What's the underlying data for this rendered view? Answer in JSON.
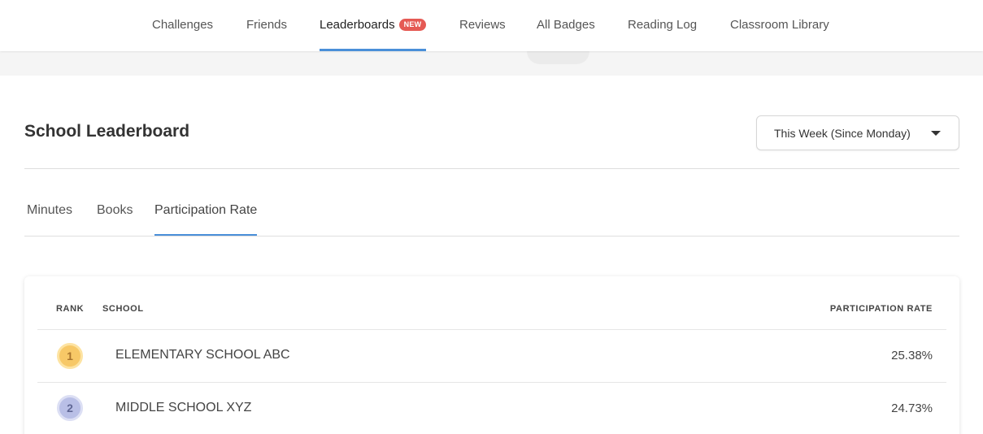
{
  "nav": {
    "items": [
      {
        "label": "Challenges"
      },
      {
        "label": "Friends"
      },
      {
        "label": "Leaderboards",
        "badge": "NEW",
        "active": true
      },
      {
        "label": "Reviews"
      },
      {
        "label": "All Badges"
      },
      {
        "label": "Reading Log"
      },
      {
        "label": "Classroom Library"
      }
    ]
  },
  "header": {
    "title": "School Leaderboard",
    "period": {
      "selected": "This Week (Since Monday)"
    }
  },
  "tabs": [
    {
      "label": "Minutes"
    },
    {
      "label": "Books"
    },
    {
      "label": "Participation Rate",
      "active": true
    }
  ],
  "table": {
    "columns": {
      "rank": "RANK",
      "school": "SCHOOL",
      "rate": "PARTICIPATION RATE"
    },
    "rows": [
      {
        "rank": "1",
        "school": "ELEMENTARY SCHOOL ABC",
        "rate": "25.38%"
      },
      {
        "rank": "2",
        "school": "MIDDLE SCHOOL XYZ",
        "rate": "24.73%"
      }
    ]
  },
  "colors": {
    "accent": "#4a8fd9",
    "badge": "#e55a54",
    "gold": "#f7c867",
    "silver": "#b9bfe6"
  }
}
